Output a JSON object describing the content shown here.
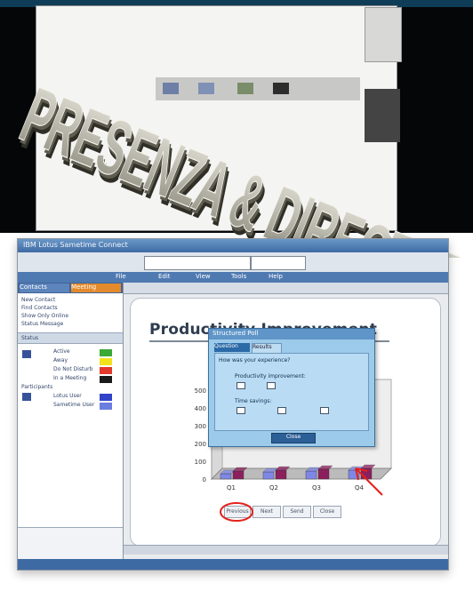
{
  "headline": "PRESENZA & DIRECTORY",
  "app": {
    "title_bar": "IBM Lotus Sametime Connect",
    "menu": [
      "File",
      "Edit",
      "View",
      "Tools",
      "Help"
    ]
  },
  "left_pane": {
    "tab_a": "Contacts",
    "tab_b": "Meeting",
    "items": [
      "New Contact",
      "Find Contacts",
      "Show Only Online",
      "Status Message"
    ],
    "group_label": "Status",
    "status_items": [
      "Active",
      "Away",
      "Do Not Disturb",
      "In a Meeting"
    ],
    "status_colors": [
      "#3aa935",
      "#f2e21c",
      "#e3382c",
      "#1a1a1a"
    ],
    "people_label": "Participants",
    "people": [
      "Lotus User",
      "Sametime User"
    ],
    "people_colors": [
      "#3143c9",
      "#6b7de0"
    ]
  },
  "slide": {
    "title": "Productivity Improvement"
  },
  "dialog": {
    "title": "Structured Poll",
    "tab_1": "Question",
    "tab_2": "Results",
    "text_1": "How was your experience?",
    "text_2": "Productivity improvement:",
    "text_3": "Time savings:",
    "button": "Close"
  },
  "page_buttons": [
    "Previous",
    "Next",
    "Send",
    "Close"
  ],
  "chart_data": {
    "type": "bar",
    "categories": [
      "Q1",
      "Q2",
      "Q3",
      "Q4"
    ],
    "series": [
      {
        "color": "#7f87e6",
        "values": [
          30,
          40,
          45,
          50
        ]
      },
      {
        "color": "#8c1f5d",
        "values": [
          45,
          50,
          55,
          60
        ]
      }
    ],
    "yticks": [
      0,
      100,
      200,
      300,
      400,
      500
    ],
    "ylim": [
      0,
      500
    ]
  }
}
